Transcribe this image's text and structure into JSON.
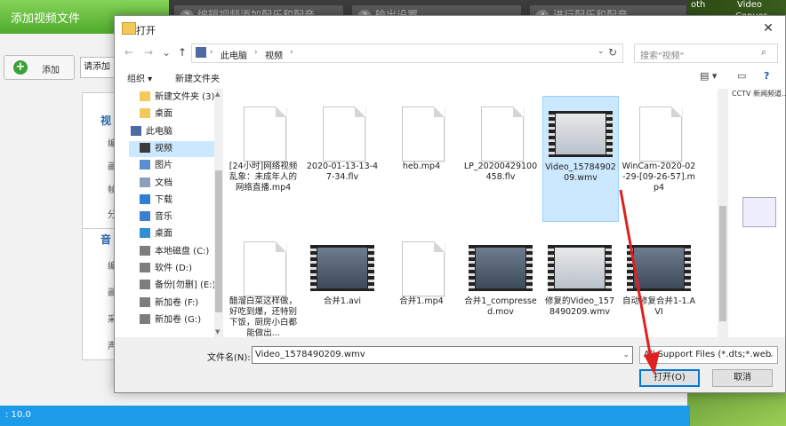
{
  "app": {
    "active_tab": "添加视频文件",
    "steps": [
      {
        "num": "2",
        "label": "编辑视频添加配乐和配音"
      },
      {
        "num": "3",
        "label": "输出设置"
      },
      {
        "num": "4",
        "label": "进行配乐和配音"
      }
    ],
    "add_button": "添加",
    "hint_input": "请添加",
    "panel_items": [
      "视",
      "编",
      "画",
      "帧",
      "分",
      "音",
      "编",
      "画",
      "采",
      "声"
    ],
    "status": ": 10.0",
    "right_labels": [
      "oth",
      "Video",
      "Conver"
    ]
  },
  "dialog": {
    "title": "打开",
    "close": "✕",
    "nav": {
      "back": "←",
      "forward": "→",
      "dropdown": "⌄",
      "up": "↑"
    },
    "breadcrumb": [
      "此电脑",
      "视频"
    ],
    "search_placeholder": "搜索\"视频\"",
    "toolbar": {
      "organize": "组织 ▾",
      "new_folder": "新建文件夹"
    },
    "nav_items": [
      {
        "label": "新建文件夹 (3)",
        "icon": "folder"
      },
      {
        "label": "桌面",
        "icon": "folder"
      },
      {
        "label": "此电脑",
        "icon": "pc"
      },
      {
        "label": "视频",
        "icon": "video",
        "selected": true
      },
      {
        "label": "图片",
        "icon": "pictures"
      },
      {
        "label": "文档",
        "icon": "documents"
      },
      {
        "label": "下载",
        "icon": "download"
      },
      {
        "label": "音乐",
        "icon": "music"
      },
      {
        "label": "桌面",
        "icon": "desktop"
      },
      {
        "label": "本地磁盘 (C:)",
        "icon": "drive"
      },
      {
        "label": "软件 (D:)",
        "icon": "drive"
      },
      {
        "label": "备份[勿删] (E:)",
        "icon": "drive"
      },
      {
        "label": "新加卷 (F:)",
        "icon": "drive"
      },
      {
        "label": "新加卷 (G:)",
        "icon": "drive"
      }
    ],
    "files": [
      {
        "name": "[24小时]网络视频乱象：未成年人的网络直播.mp4",
        "kind": "doc"
      },
      {
        "name": "2020-01-13-13-47-34.flv",
        "kind": "doc"
      },
      {
        "name": "heb.mp4",
        "kind": "doc"
      },
      {
        "name": "LP_20200429100458.flv",
        "kind": "doc"
      },
      {
        "name": "Video_1578490209.wmv",
        "kind": "video-ui",
        "selected": true
      },
      {
        "name": "WinCam-2020-02-29-[09-26-57].mp4",
        "kind": "doc"
      },
      {
        "name": "醋溜白菜这样做，好吃到爆，还特别下饭，厨房小白都能做出...",
        "kind": "doc"
      },
      {
        "name": "合并1.avi",
        "kind": "video"
      },
      {
        "name": "合并1.mp4",
        "kind": "doc"
      },
      {
        "name": "合并1_compressed.mov",
        "kind": "video"
      },
      {
        "name": "修复的Video_1578490209.wmv",
        "kind": "video-ui"
      },
      {
        "name": "自动修复合并1-1.AVI",
        "kind": "video"
      }
    ],
    "preview_text": "CCTV 新闻频道...",
    "file_name_label": "文件名(N):",
    "file_name_value": "Video_1578490209.wmv",
    "filter_value": "All Support Files (*.dts;*.web",
    "open_button": "打开(O)",
    "cancel_button": "取消"
  }
}
